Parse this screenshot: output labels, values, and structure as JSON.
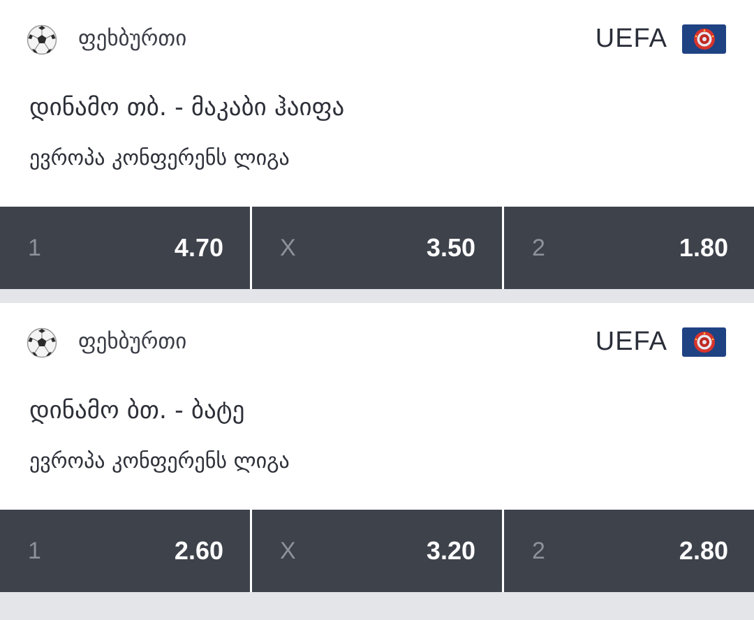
{
  "events": [
    {
      "sport": "ფეხბურთი",
      "sport_icon": "soccer-ball-icon",
      "organization": "UEFA",
      "organization_icon": "uefa-logo-icon",
      "match": "დინამო თბ. - მაკაბი ჰაიფა",
      "league": "ევროპა კონფერენს ლიგა",
      "odds": [
        {
          "key": "1",
          "value": "4.70"
        },
        {
          "key": "X",
          "value": "3.50"
        },
        {
          "key": "2",
          "value": "1.80"
        }
      ]
    },
    {
      "sport": "ფეხბურთი",
      "sport_icon": "soccer-ball-icon",
      "organization": "UEFA",
      "organization_icon": "uefa-logo-icon",
      "match": "დინამო ბთ. - ბატე",
      "league": "ევროპა კონფერენს ლიგა",
      "odds": [
        {
          "key": "1",
          "value": "2.60"
        },
        {
          "key": "X",
          "value": "3.20"
        },
        {
          "key": "2",
          "value": "2.80"
        }
      ]
    }
  ],
  "colors": {
    "background": "#e4e5e8",
    "card": "#ffffff",
    "odds_button": "#3e424b",
    "odds_key": "#8e929a",
    "odds_value": "#ffffff",
    "uefa_badge": "#1f4283"
  }
}
